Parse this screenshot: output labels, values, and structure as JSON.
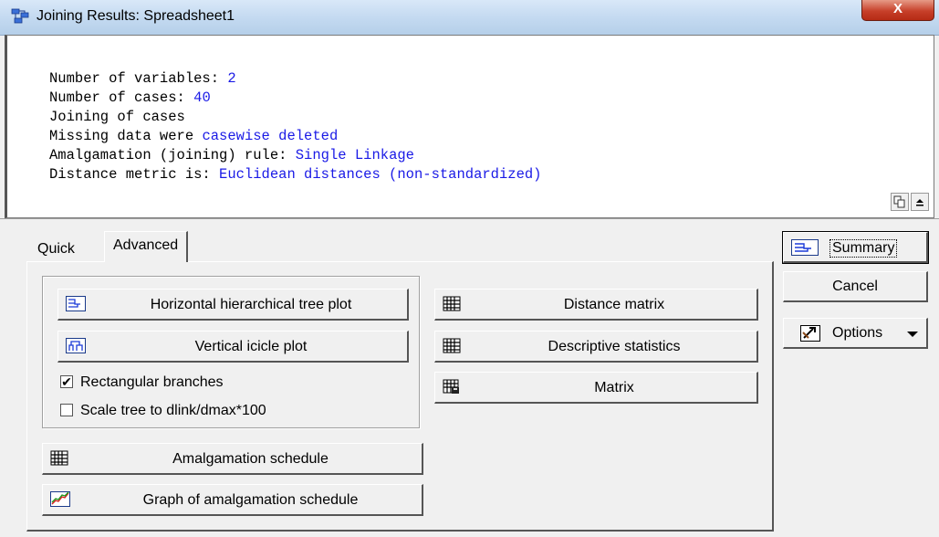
{
  "window": {
    "title": "Joining Results: Spreadsheet1",
    "close_label": "X"
  },
  "output": {
    "lines": [
      {
        "label": "Number of variables: ",
        "value": "2"
      },
      {
        "label": "Number of cases: ",
        "value": "40"
      },
      {
        "label": "Joining of cases",
        "value": ""
      },
      {
        "label": "Missing data were ",
        "value": "casewise deleted"
      },
      {
        "label": "Amalgamation (joining) rule: ",
        "value": "Single Linkage"
      },
      {
        "label": "Distance metric is: ",
        "value": "Euclidean distances (non-standardized)"
      }
    ]
  },
  "tabs": {
    "quick": "Quick",
    "advanced": "Advanced"
  },
  "buttons": {
    "horizontal_tree": "Horizontal hierarchical tree plot",
    "vertical_icicle": "Vertical icicle plot",
    "distance_matrix": "Distance matrix",
    "descriptive_stats": "Descriptive statistics",
    "matrix": "Matrix",
    "amalgamation_schedule": "Amalgamation schedule",
    "graph_amalgamation": "Graph of amalgamation schedule"
  },
  "checkboxes": {
    "rectangular": {
      "label": "Rectangular branches",
      "checked": true
    },
    "scale_tree": {
      "label": "Scale tree to dlink/dmax*100",
      "checked": false
    }
  },
  "side": {
    "summary": "Summary",
    "cancel": "Cancel",
    "options": "Options"
  },
  "colors": {
    "value_text": "#1a1ae6",
    "title_bar": "#c4daf1",
    "close_button": "#c7402a"
  }
}
